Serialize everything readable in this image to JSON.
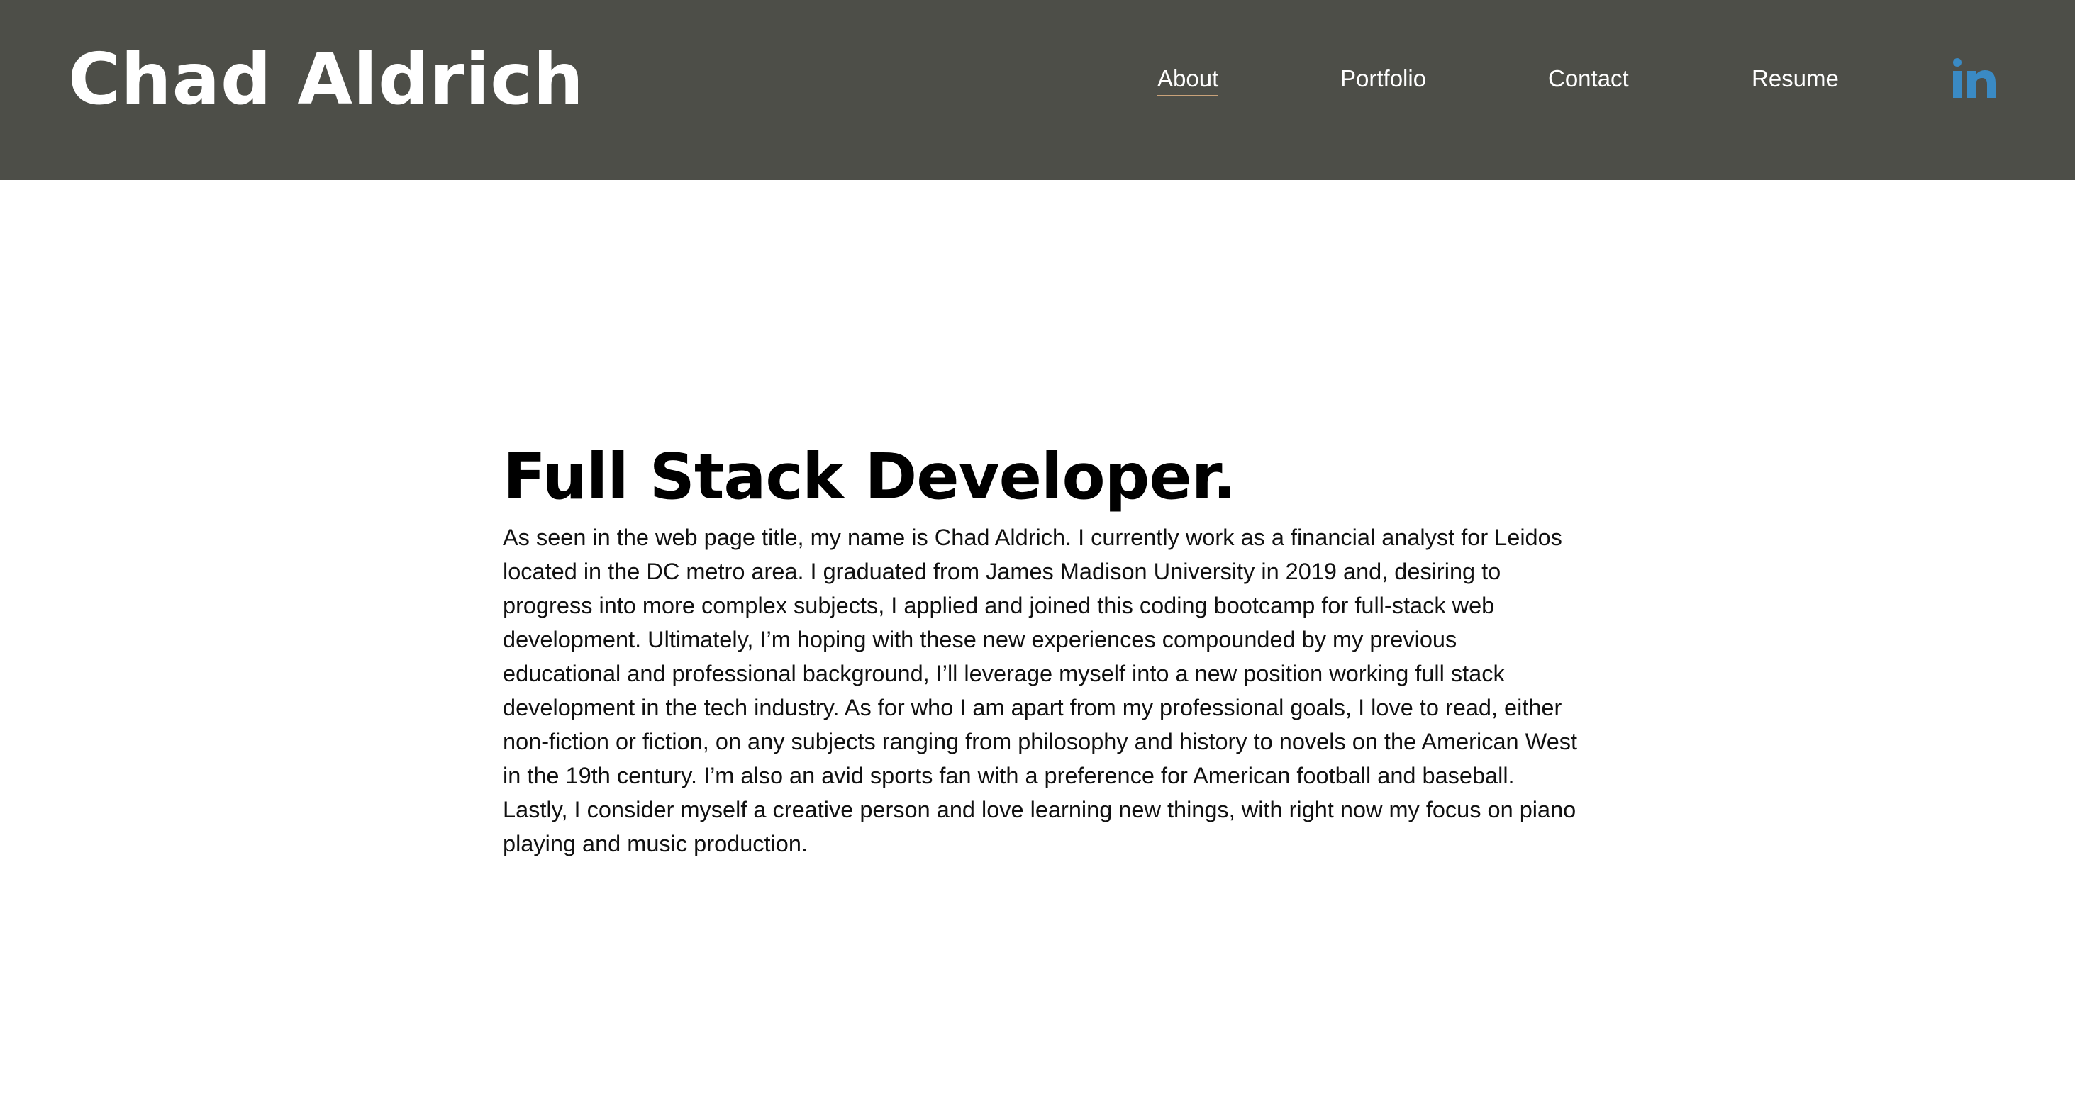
{
  "header": {
    "brand": "Chad Aldrich",
    "nav": {
      "about": "About",
      "portfolio": "Portfolio",
      "contact": "Contact",
      "resume": "Resume"
    },
    "active_item": "About",
    "social_icon": "linkedin-icon",
    "social_icon_color": "#3a8ac4"
  },
  "main": {
    "title": "Full Stack Developer.",
    "paragraph": "As seen in the web page title, my name is Chad Aldrich. I currently work as a financial analyst for Leidos located in the DC metro area. I graduated from James Madison University in 2019 and, desiring to progress into more complex subjects, I applied and joined this coding bootcamp for full-stack web development. Ultimately, I’m hoping with these new experiences compounded by my previous educational and professional background, I’ll leverage myself into a new position working full stack development in the tech industry. As for who I am apart from my professional goals, I love to read, either non-fiction or fiction, on any subjects ranging from philosophy and history to novels on the American West in the 19th century. I’m also an avid sports fan with a preference for American football and baseball. Lastly, I consider myself a creative person and love learning new things, with right now my focus on piano playing and music production."
  },
  "colors": {
    "header_background": "#4d4e48",
    "active_underline": "#c9a27a",
    "page_background": "#ffffff"
  }
}
